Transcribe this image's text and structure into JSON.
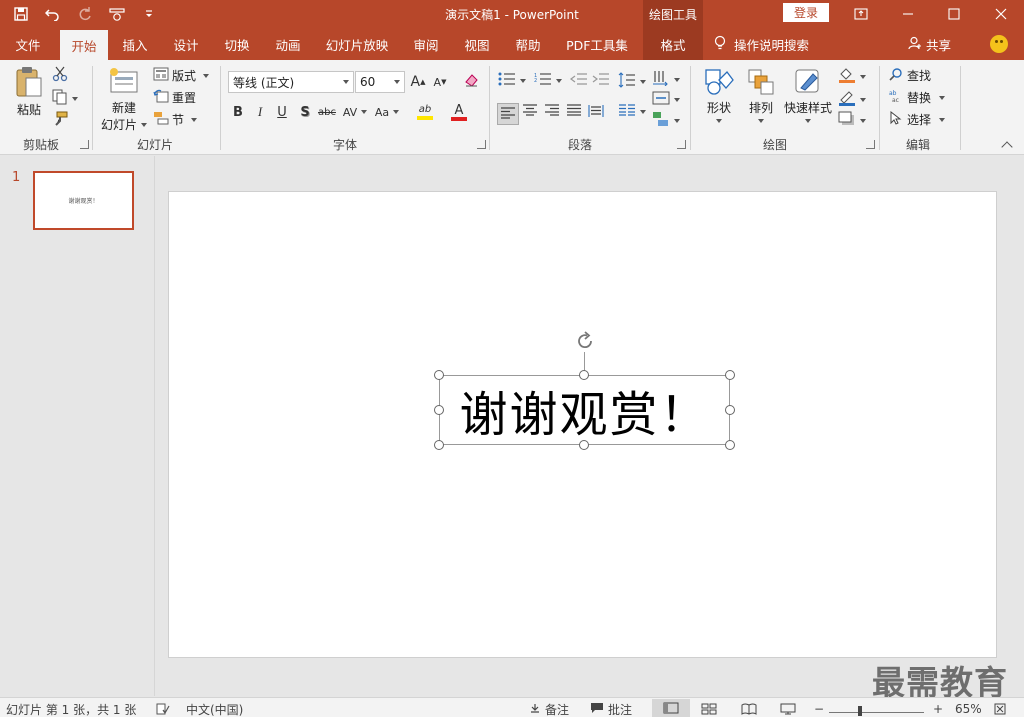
{
  "titlebar": {
    "title": "演示文稿1  -  PowerPoint",
    "context_group": "绘图工具",
    "login": "登录",
    "accent": "#b7472a"
  },
  "tabs": [
    "文件",
    "开始",
    "插入",
    "设计",
    "切换",
    "动画",
    "幻灯片放映",
    "审阅",
    "视图",
    "帮助",
    "PDF工具集",
    "格式"
  ],
  "active_tab": "开始",
  "tellme": "操作说明搜索",
  "share": "共享",
  "ribbon": {
    "clipboard": {
      "paste": "粘贴",
      "label": "剪贴板"
    },
    "slides": {
      "new_slide_line1": "新建",
      "new_slide_line2": "幻灯片",
      "layout": "版式",
      "reset": "重置",
      "section": "节",
      "label": "幻灯片"
    },
    "font": {
      "font_name": "等线 (正文)",
      "font_size": "60",
      "label": "字体",
      "bold": "B",
      "italic": "I",
      "underline": "U",
      "shadow": "S",
      "strike": "abc",
      "spacing": "AV",
      "case": "Aa",
      "grow": "A",
      "shrink": "A",
      "color_a": "A",
      "highlight": "ab"
    },
    "paragraph": {
      "label": "段落"
    },
    "drawing": {
      "shapes": "形状",
      "arrange": "排列",
      "quick_styles": "快速样式",
      "label": "绘图"
    },
    "editing": {
      "find": "查找",
      "replace": "替换",
      "select": "选择",
      "label": "编辑"
    }
  },
  "thumbnails": [
    {
      "number": "1",
      "text": "谢谢观赏！"
    }
  ],
  "slide": {
    "text": "谢谢观赏！"
  },
  "statusbar": {
    "slide_info": "幻灯片 第 1 张，共 1 张",
    "language": "中文(中国)",
    "notes": "备注",
    "comments": "批注",
    "zoom": "65%"
  },
  "watermark": "最需教育"
}
